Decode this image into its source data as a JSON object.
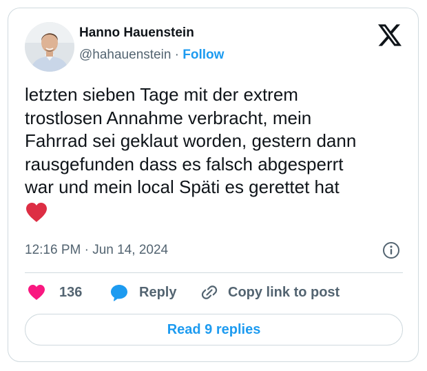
{
  "author": {
    "name": "Hanno Hauenstein",
    "handle": "@hahauenstein",
    "separator": "·",
    "follow_label": "Follow",
    "avatar_icon": "profile-photo"
  },
  "brand": {
    "logo_icon": "x-logo"
  },
  "tweet": {
    "lines": [
      "letzten sieben Tage mit der extrem",
      "trostlosen Annahme verbracht, mein",
      "Fahrrad sei geklaut worden, gestern dann",
      "rausgefunden dass es falsch abgesperrt",
      "war und mein local Späti es gerettet hat"
    ],
    "emoji": "red-heart-emoji",
    "timestamp": "12:16 PM · Jun 14, 2024"
  },
  "actions": {
    "like_count": "136",
    "reply_label": "Reply",
    "copy_link_label": "Copy link to post",
    "read_replies_label": "Read 9 replies"
  },
  "colors": {
    "accent": "#1d9bf0",
    "like": "#f91880",
    "text": "#0f1419",
    "muted": "#536471",
    "border": "#cfd9de"
  }
}
